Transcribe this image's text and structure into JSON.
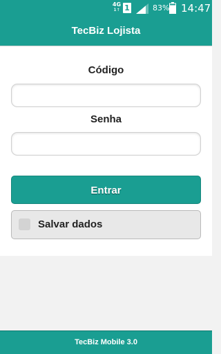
{
  "status_bar": {
    "network": "4G",
    "network_sub": "1↑",
    "sim": "1",
    "battery_percent": "83%",
    "time": "14:47"
  },
  "app_bar": {
    "title": "TecBiz Lojista"
  },
  "form": {
    "codigo_label": "Código",
    "codigo_value": "",
    "senha_label": "Senha",
    "senha_value": "",
    "submit_label": "Entrar",
    "save_label": "Salvar dados",
    "save_checked": false
  },
  "footer": {
    "text": "TecBiz Mobile 3.0"
  },
  "colors": {
    "primary": "#1a9e92",
    "background": "#f2f2f2",
    "panel": "#ffffff"
  },
  "icons": [
    "signal-icon",
    "battery-icon",
    "sim-icon"
  ]
}
